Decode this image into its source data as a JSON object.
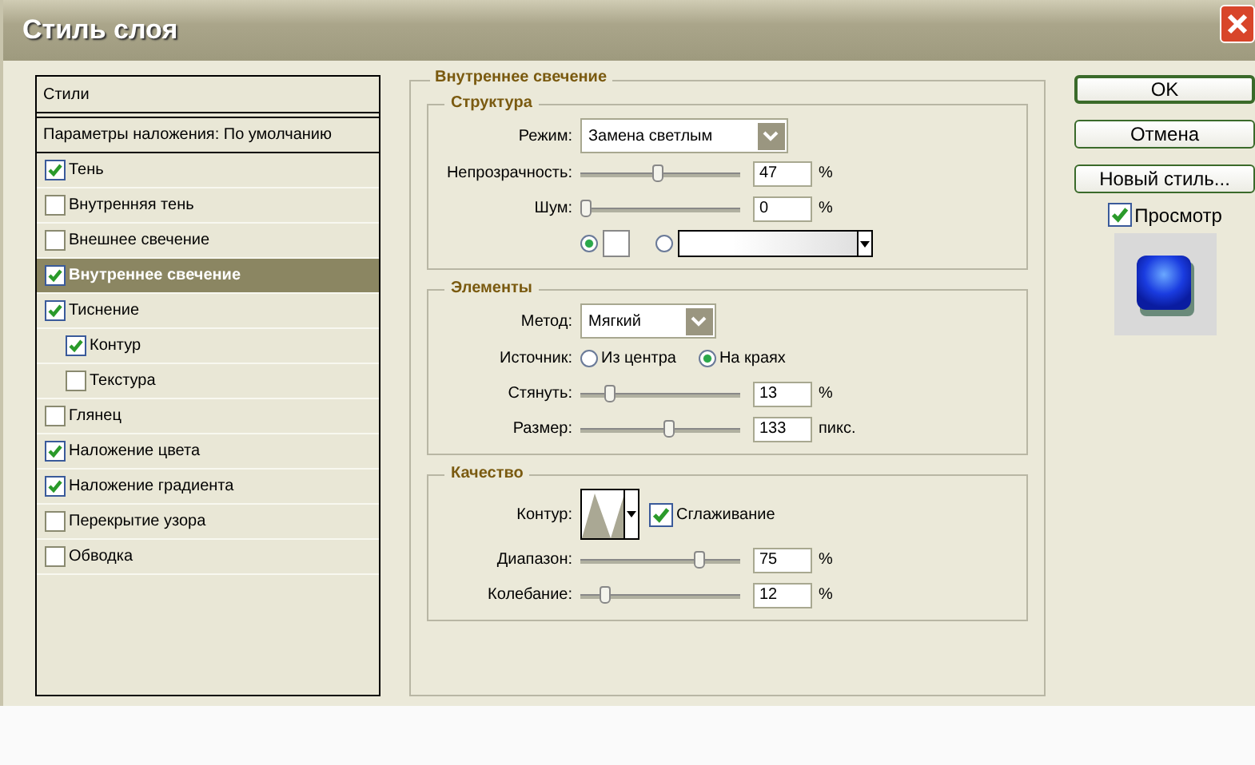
{
  "window": {
    "title": "Стиль слоя"
  },
  "styles_list": {
    "header": "Стили",
    "blending": "Параметры наложения: По умолчанию",
    "items": [
      {
        "label": "Тень",
        "checked": true,
        "selected": false
      },
      {
        "label": "Внутренняя тень",
        "checked": false,
        "selected": false
      },
      {
        "label": "Внешнее свечение",
        "checked": false,
        "selected": false
      },
      {
        "label": "Внутреннее свечение",
        "checked": true,
        "selected": true
      },
      {
        "label": "Тиснение",
        "checked": true,
        "selected": false,
        "children": [
          {
            "label": "Контур",
            "checked": true,
            "selected": false
          },
          {
            "label": "Текстура",
            "checked": false,
            "selected": false
          }
        ]
      },
      {
        "label": "Глянец",
        "checked": false,
        "selected": false
      },
      {
        "label": "Наложение цвета",
        "checked": true,
        "selected": false
      },
      {
        "label": "Наложение градиента",
        "checked": true,
        "selected": false
      },
      {
        "label": "Перекрытие узора",
        "checked": false,
        "selected": false
      },
      {
        "label": "Обводка",
        "checked": false,
        "selected": false
      }
    ]
  },
  "panel": {
    "title": "Внутреннее свечение",
    "sections": [
      {
        "title": "Структура",
        "rows": [
          {
            "kind": "select",
            "label": "Режим:",
            "value": "Замена светлым"
          },
          {
            "kind": "slider",
            "label": "Непрозрачность:",
            "level": 0.48,
            "value": "47",
            "unit": "%"
          },
          {
            "kind": "slider",
            "label": "Шум:",
            "level": 0,
            "value": "0",
            "unit": "%"
          },
          {
            "kind": "fill",
            "options": [
              {
                "kind": "color",
                "selected": true
              },
              {
                "kind": "gradient",
                "selected": false
              }
            ]
          }
        ]
      },
      {
        "title": "Элементы",
        "rows": [
          {
            "kind": "select",
            "label": "Метод:",
            "value": "Мягкий"
          },
          {
            "kind": "radio",
            "label": "Источник:",
            "options": [
              {
                "label": "Из центра",
                "selected": false
              },
              {
                "label": "На краях",
                "selected": true
              }
            ]
          },
          {
            "kind": "slider",
            "label": "Стянуть:",
            "level": 0.16,
            "value": "13",
            "unit": "%"
          },
          {
            "kind": "slider",
            "label": "Размер:",
            "level": 0.56,
            "value": "133",
            "unit": "пикс."
          }
        ]
      },
      {
        "title": "Качество",
        "rows": [
          {
            "kind": "contour",
            "label": "Контур:",
            "checkbox": {
              "label": "Сглаживание",
              "checked": true
            }
          },
          {
            "kind": "slider",
            "label": "Диапазон:",
            "level": 0.76,
            "value": "75",
            "unit": "%"
          },
          {
            "kind": "slider",
            "label": "Колебание:",
            "level": 0.13,
            "value": "12",
            "unit": "%"
          }
        ]
      }
    ]
  },
  "buttons": [
    {
      "label": "OK",
      "default": true
    },
    {
      "label": "Отмена",
      "default": false
    },
    {
      "label": "Новый стиль...",
      "default": false
    }
  ],
  "preview": {
    "label": "Просмотр",
    "checked": true
  }
}
